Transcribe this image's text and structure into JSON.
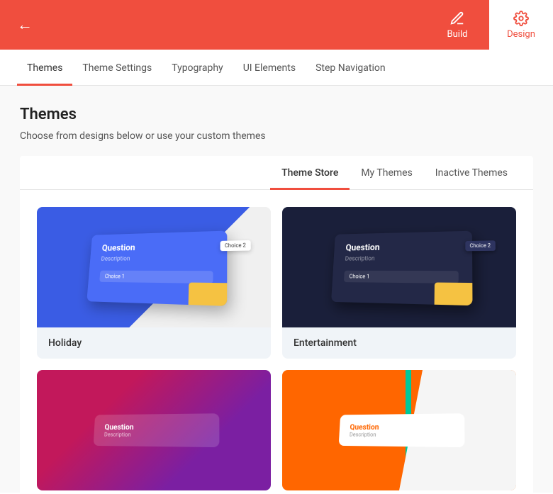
{
  "header": {
    "back_icon": "←",
    "build_label": "Build",
    "design_label": "Design"
  },
  "nav": {
    "tabs": [
      {
        "id": "themes",
        "label": "Themes",
        "active": true
      },
      {
        "id": "theme-settings",
        "label": "Theme Settings",
        "active": false
      },
      {
        "id": "typography",
        "label": "Typography",
        "active": false
      },
      {
        "id": "ui-elements",
        "label": "UI Elements",
        "active": false
      },
      {
        "id": "step-navigation",
        "label": "Step Navigation",
        "active": false
      }
    ]
  },
  "main": {
    "title": "Themes",
    "subtitle": "Choose from designs below or use your custom themes",
    "theme_tabs": [
      {
        "id": "theme-store",
        "label": "Theme Store",
        "active": true
      },
      {
        "id": "my-themes",
        "label": "My Themes",
        "active": false
      },
      {
        "id": "inactive-themes",
        "label": "Inactive Themes",
        "active": false
      }
    ],
    "themes": [
      {
        "id": "holiday",
        "name": "Holiday"
      },
      {
        "id": "entertainment",
        "name": "Entertainment"
      },
      {
        "id": "purple",
        "name": ""
      },
      {
        "id": "orange",
        "name": ""
      }
    ]
  }
}
